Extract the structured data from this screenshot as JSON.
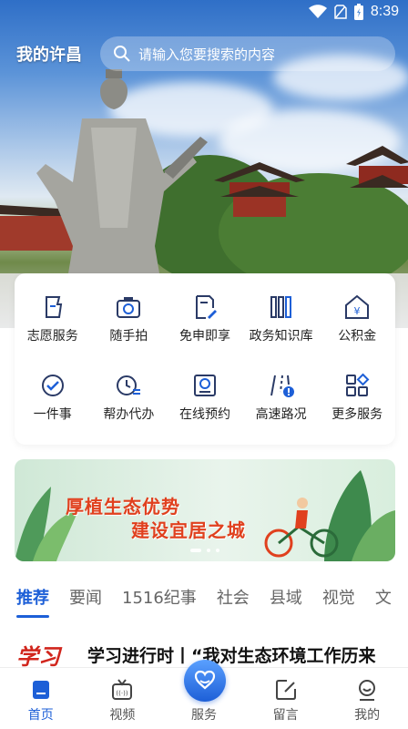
{
  "status_bar": {
    "time": "8:39"
  },
  "header": {
    "city": "我的许昌",
    "search_placeholder": "请输入您要搜索的内容"
  },
  "services": [
    {
      "label": "志愿服务",
      "icon": "flag-icon"
    },
    {
      "label": "随手拍",
      "icon": "camera-icon"
    },
    {
      "label": "免申即享",
      "icon": "document-edit-icon"
    },
    {
      "label": "政务知识库",
      "icon": "books-icon"
    },
    {
      "label": "公积金",
      "icon": "yuan-house-icon"
    },
    {
      "label": "一件事",
      "icon": "check-circle-icon"
    },
    {
      "label": "帮办代办",
      "icon": "clock-list-icon"
    },
    {
      "label": "在线预约",
      "icon": "calendar-clock-icon"
    },
    {
      "label": "高速路况",
      "icon": "road-alert-icon"
    },
    {
      "label": "更多服务",
      "icon": "grid-more-icon"
    }
  ],
  "banner": {
    "line1": "厚植生态优势",
    "line2": "建设宜居之城"
  },
  "tabs": [
    "推荐",
    "要闻",
    "1516纪事",
    "社会",
    "县域",
    "视觉",
    "文"
  ],
  "news": {
    "logo_text": "学习",
    "title": "学习进行时丨“我对生态环境工作历来"
  },
  "bottom_nav": [
    {
      "label": "首页",
      "icon": "home-icon"
    },
    {
      "label": "视频",
      "icon": "tv-icon"
    },
    {
      "label": "服务",
      "icon": "heart-hands-icon"
    },
    {
      "label": "留言",
      "icon": "message-edit-icon"
    },
    {
      "label": "我的",
      "icon": "user-icon"
    }
  ],
  "colors": {
    "accent": "#1d5fd7",
    "banner_text": "#e0401e"
  }
}
